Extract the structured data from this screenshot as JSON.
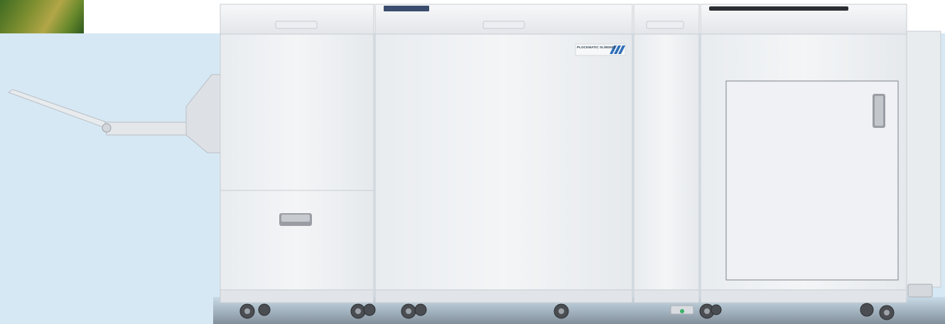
{
  "image": {
    "subject": "production printer with finisher units",
    "brand_plate": "PLOCKMATIC SL/MS60x",
    "colors": {
      "background": "#d6e8f4",
      "panel": "#eef0f3",
      "panel_edge": "#c9ccd1",
      "accent_stripe": "#2f6fb8",
      "wheel": "#4a4d52"
    }
  }
}
